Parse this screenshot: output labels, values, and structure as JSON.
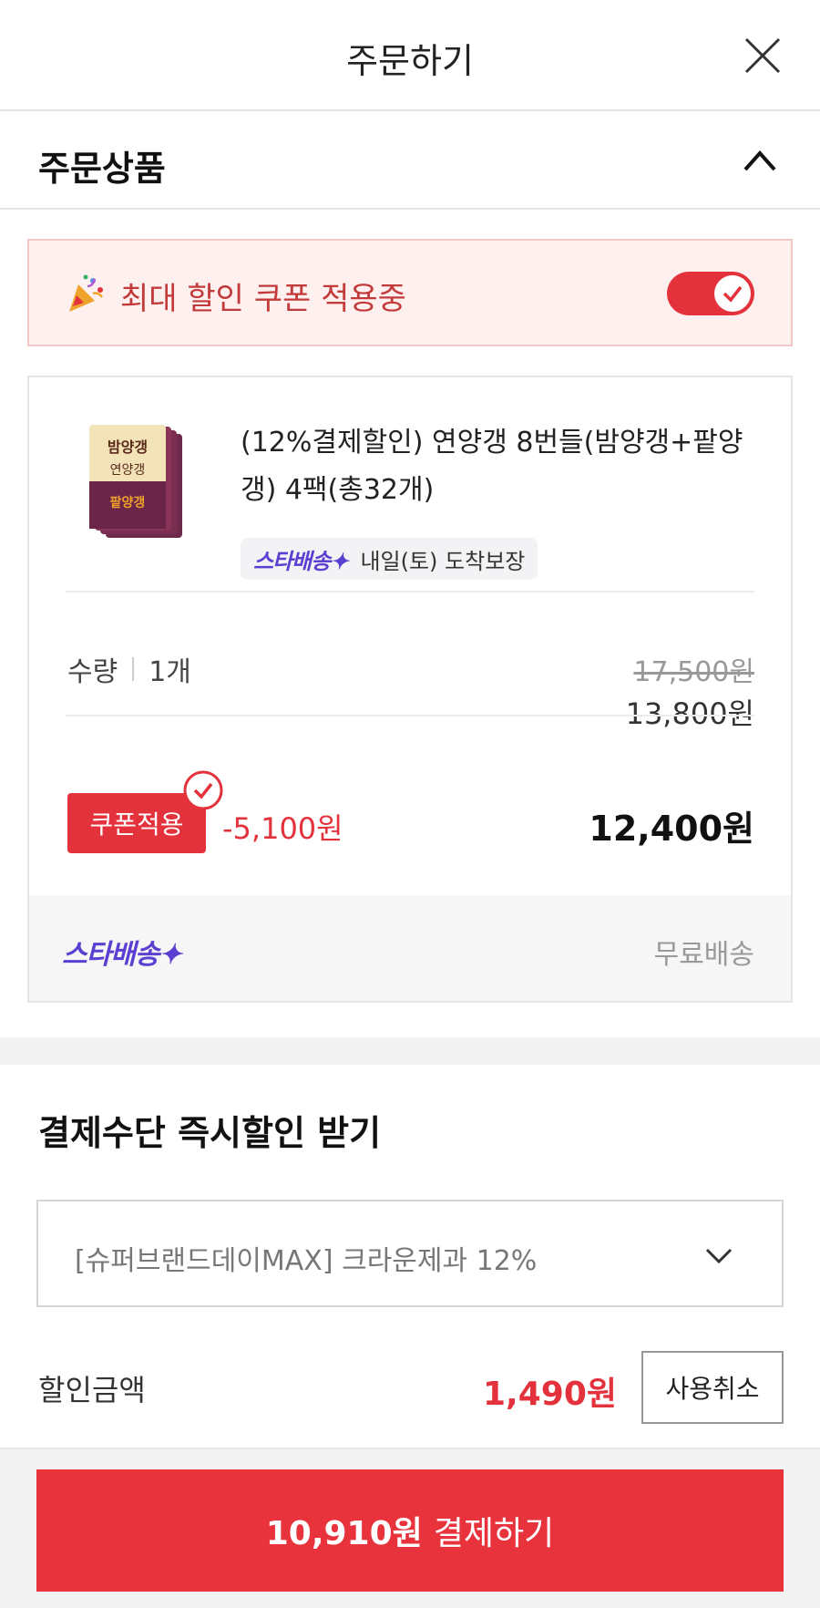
{
  "header": {
    "title": "주문하기",
    "close_icon": "close-icon"
  },
  "order_section": {
    "title": "주문상품",
    "collapse_icon": "chevron-up-icon"
  },
  "coupon_banner": {
    "icon": "party-popper-icon",
    "text": "최대 할인 쿠폰 적용중",
    "toggle_on": true
  },
  "product": {
    "name": "(12%결제할인) 연양갱 8번들(밤양갱+팥양갱) 4팩(총32개)",
    "delivery_logo": "스타배송✦",
    "delivery_text": "내일(토) 도착보장",
    "quantity_label": "수량",
    "quantity_value": "1개",
    "original_price": "17,500원",
    "sale_price": "13,800원",
    "coupon_badge": "쿠폰적용",
    "coupon_discount": "-5,100원",
    "final_price": "12,400원",
    "shipping_logo": "스타배송✦",
    "shipping_text": "무료배송"
  },
  "payment": {
    "title": "결제수단 즉시할인 받기",
    "selected_option": "[슈퍼브랜드데이MAX] 크라운제과 12%",
    "discount_label": "할인금액",
    "discount_value": "1,490원",
    "cancel_label": "사용취소"
  },
  "checkout": {
    "amount": "10,910원",
    "label": "결제하기"
  },
  "colors": {
    "accent": "#e4323c",
    "delivery_brand": "#5b3fd1",
    "banner_bg": "#fdf0ef"
  }
}
